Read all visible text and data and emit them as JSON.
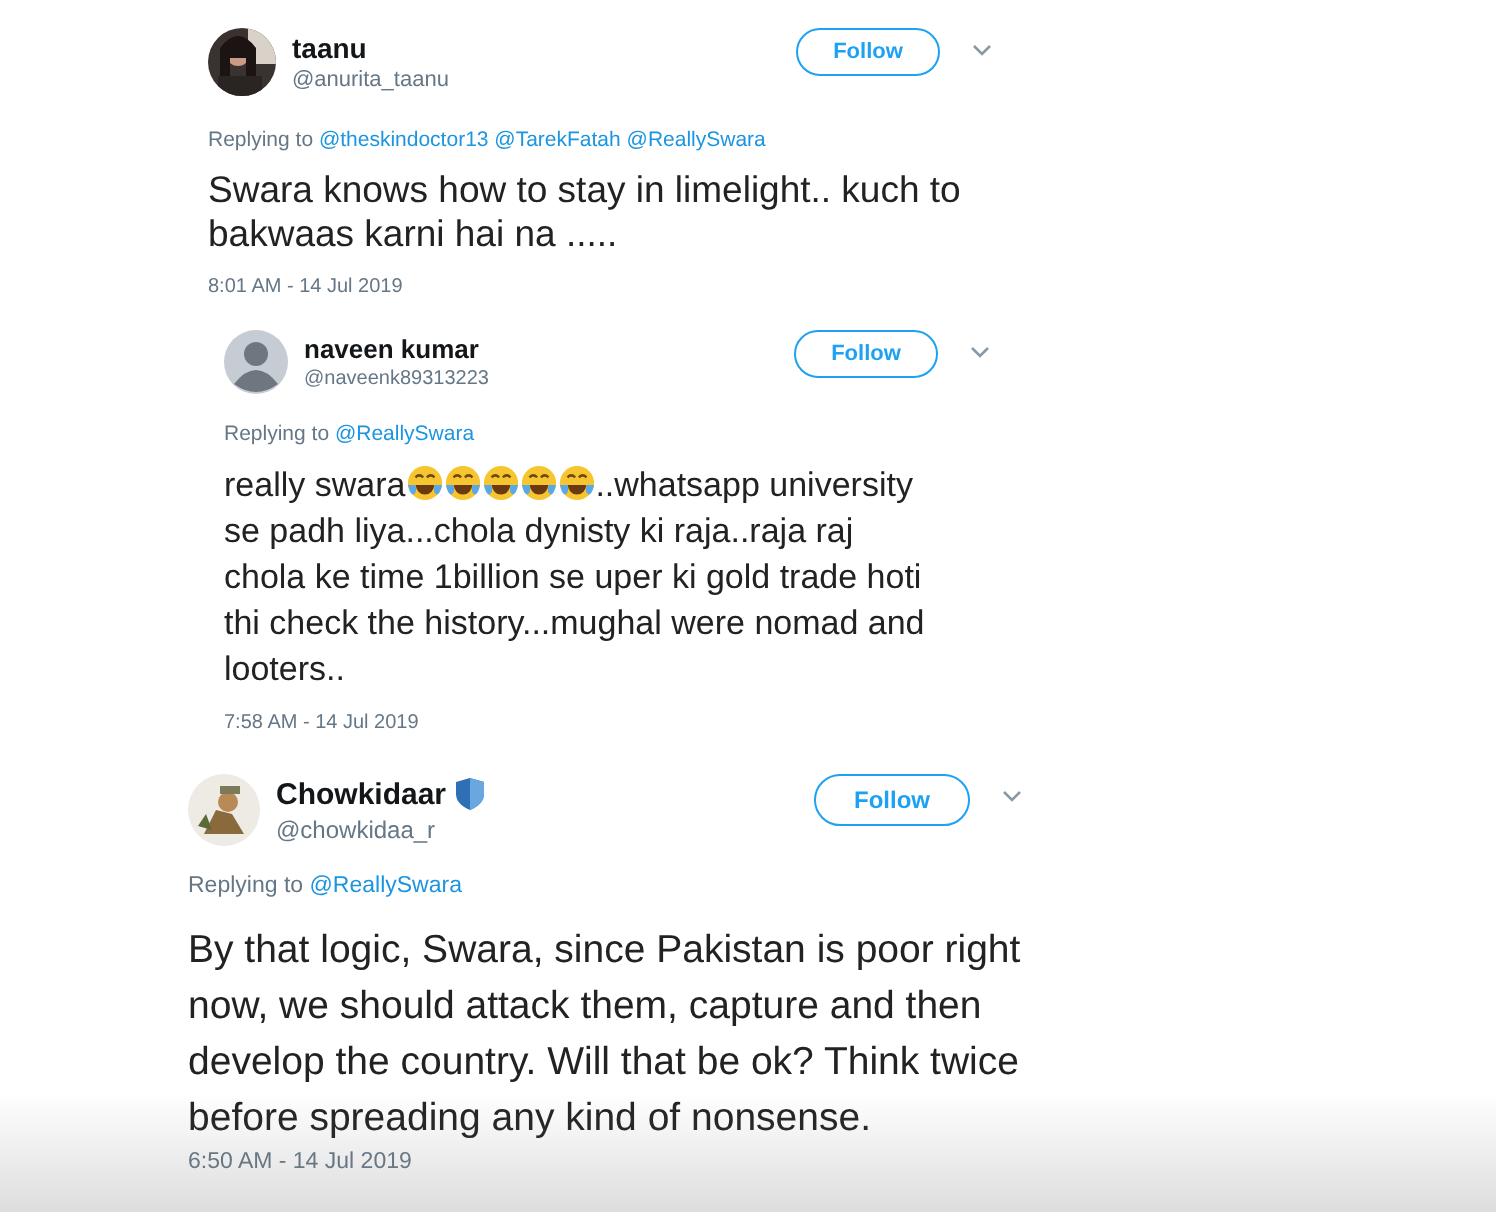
{
  "tweets": [
    {
      "name": "taanu",
      "handle": "@anurita_taanu",
      "verified": false,
      "follow": "Follow",
      "replying_to": "Replying to",
      "mentions": [
        "@theskindoctor13",
        "@TarekFatah",
        "@ReallySwara"
      ],
      "body": [
        {
          "kind": "text",
          "text": "Swara knows how to stay in limelight.. kuch to bakwaas karni hai na ....."
        }
      ],
      "time": "8:01 AM - 14 Jul 2019"
    },
    {
      "name": "naveen kumar",
      "handle": "@naveenk89313223",
      "verified": false,
      "avatar": {
        "kind": "default"
      },
      "follow": "Follow",
      "replying_to": "Replying to",
      "mentions": [
        "@ReallySwara"
      ],
      "body": [
        {
          "kind": "text",
          "text": "really swara"
        },
        {
          "kind": "emoji"
        },
        {
          "kind": "emoji"
        },
        {
          "kind": "emoji"
        },
        {
          "kind": "emoji"
        },
        {
          "kind": "emoji"
        },
        {
          "kind": "text",
          "text": "..whatsapp university se padh liya...chola dynisty ki raja..raja raj  chola ke time 1billion se uper ki gold trade hoti thi check the history...mughal were nomad and looters.."
        }
      ],
      "time": "7:58 AM - 14 Jul 2019"
    },
    {
      "name": "Chowkidaar",
      "handle": "@chowkidaa_r",
      "verified": true,
      "follow": "Follow",
      "replying_to": "Replying to",
      "mentions": [
        "@ReallySwara"
      ],
      "body": [
        {
          "kind": "text",
          "text": "By that logic, Swara, since Pakistan is poor right now, we should attack them, capture and then develop the country. Will that be ok? Think twice before spreading any kind of nonsense."
        }
      ],
      "time": "6:50 AM - 14 Jul 2019"
    }
  ]
}
